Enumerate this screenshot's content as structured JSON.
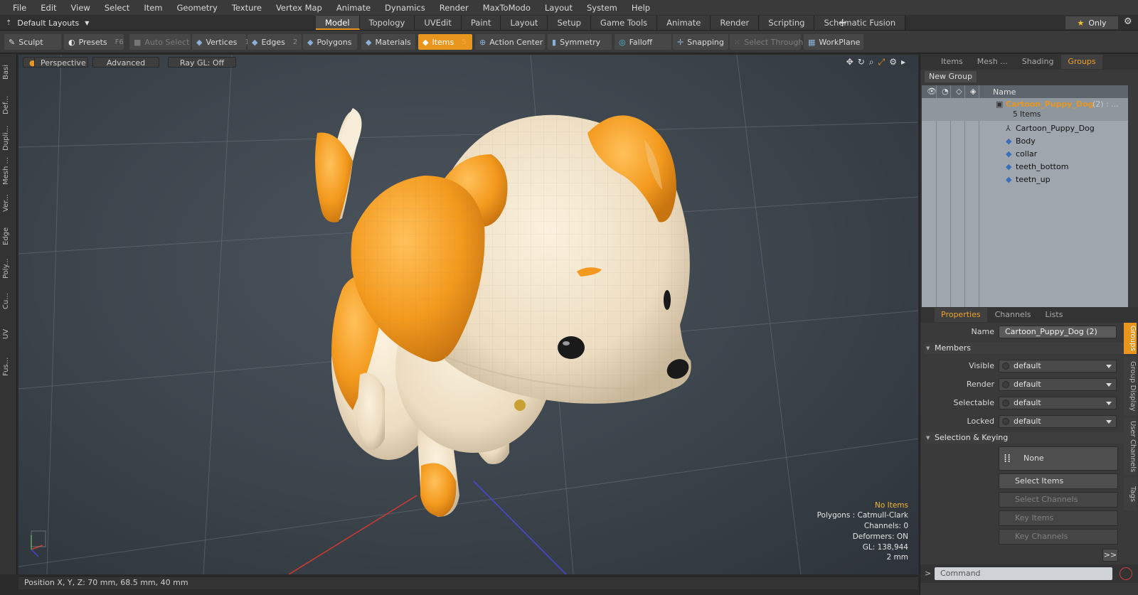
{
  "menu": [
    "File",
    "Edit",
    "View",
    "Select",
    "Item",
    "Geometry",
    "Texture",
    "Vertex Map",
    "Animate",
    "Dynamics",
    "Render",
    "MaxToModo",
    "Layout",
    "System",
    "Help"
  ],
  "layout_dropdown": "Default Layouts",
  "layout_tabs": [
    "Model",
    "Topology",
    "UVEdit",
    "Paint",
    "Layout",
    "Setup",
    "Game Tools",
    "Animate",
    "Render",
    "Scripting",
    "Schematic Fusion"
  ],
  "only_label": "Only",
  "toolbar": {
    "sculpt": "Sculpt",
    "presets": "Presets",
    "presets_key": "F6",
    "auto_select": "Auto Select",
    "vertices": "Vertices",
    "vertices_key": "1",
    "edges": "Edges",
    "edges_key": "2",
    "polygons": "Polygons",
    "materials": "Materials",
    "items": "Items",
    "items_key": "5",
    "action_center": "Action Center",
    "symmetry": "Symmetry",
    "falloff": "Falloff",
    "snapping": "Snapping",
    "select_through": "Select Through",
    "workplane": "WorkPlane"
  },
  "left_tabs": [
    "Basi",
    "Def...",
    "Dupli...",
    "Mesh ...",
    "Ver...",
    "Edge",
    "Poly...",
    "Cu...",
    "UV",
    "Fus..."
  ],
  "viewport": {
    "perspective": "Perspective",
    "advanced": "Advanced",
    "raygl": "Ray GL: Off",
    "info": {
      "items": "No Items",
      "polygons": "Polygons : Catmull-Clark",
      "channels": "Channels: 0",
      "deformers": "Deformers: ON",
      "gl": "GL: 138,944",
      "scale": "2 mm"
    }
  },
  "status": "Position X, Y, Z:  70 mm, 68.5 mm, 40 mm",
  "top_panel_tabs": [
    "Items",
    "Mesh ...",
    "Shading",
    "Groups"
  ],
  "new_group": "New Group",
  "tree": {
    "name_header": "Name",
    "group_name": "Cartoon_Puppy_Dog",
    "group_count": "(2) : ...",
    "group_sub": "5 Items",
    "children": [
      "Cartoon_Puppy_Dog",
      "Body",
      "collar",
      "teeth_bottom",
      "teetn_up"
    ]
  },
  "props_tabs": [
    "Properties",
    "Channels",
    "Lists"
  ],
  "props": {
    "name_label": "Name",
    "name_value": "Cartoon_Puppy_Dog (2)",
    "members_section": "Members",
    "visible_label": "Visible",
    "visible_value": "default",
    "render_label": "Render",
    "render_value": "default",
    "selectable_label": "Selectable",
    "selectable_value": "default",
    "locked_label": "Locked",
    "locked_value": "default",
    "sel_section": "Selection & Keying",
    "none_btn": "None",
    "select_items": "Select Items",
    "select_channels": "Select Channels",
    "key_items": "Key Items",
    "key_channels": "Key Channels",
    "more": ">>"
  },
  "side_tabs": [
    "Groups",
    "Group Display",
    "User Channels",
    "Tags"
  ],
  "command_placeholder": "Command",
  "colors": {
    "accent": "#e8961e",
    "warn_text": "#f2b632",
    "puppy_orange": "#f39a1e",
    "puppy_cream": "#f2e3c8"
  }
}
